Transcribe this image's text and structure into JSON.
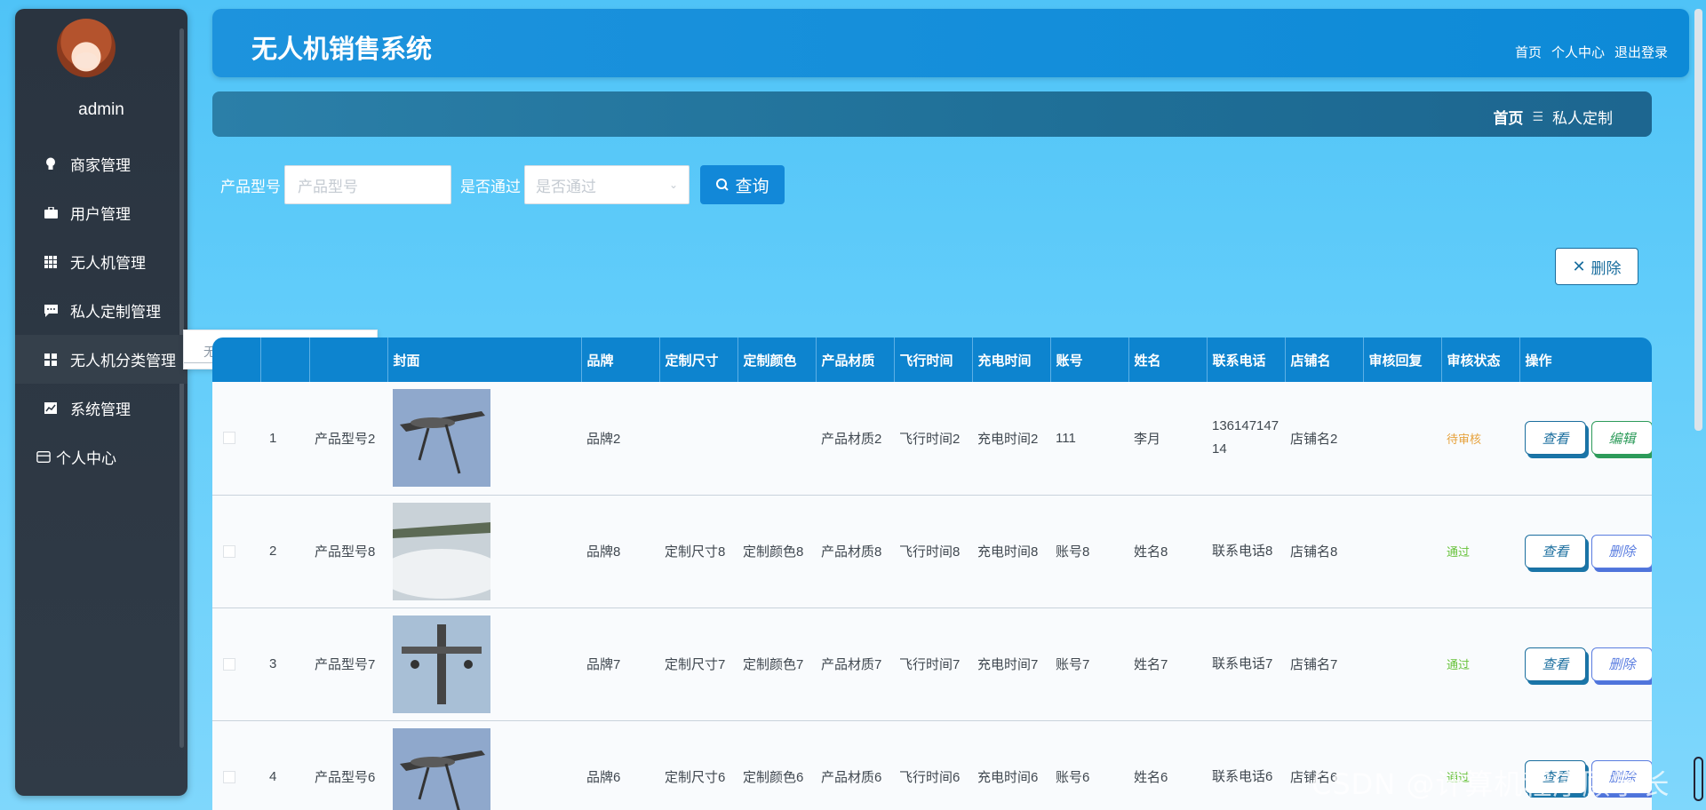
{
  "user": {
    "name": "admin"
  },
  "sidebar": {
    "items": [
      {
        "label": "商家管理",
        "icon": "lightbulb-icon"
      },
      {
        "label": "用户管理",
        "icon": "briefcase-icon"
      },
      {
        "label": "无人机管理",
        "icon": "grid-icon"
      },
      {
        "label": "私人定制管理",
        "icon": "chat-icon"
      },
      {
        "label": "无人机分类管理",
        "icon": "apps-icon"
      },
      {
        "label": "系统管理",
        "icon": "chart-icon"
      },
      {
        "label": "个人中心",
        "icon": "card-icon"
      }
    ],
    "submenu": {
      "label": "无人机分类"
    }
  },
  "header": {
    "title": "无人机销售系统",
    "links": [
      "首页",
      "个人中心",
      "退出登录"
    ]
  },
  "breadcrumb": {
    "home": "首页",
    "current": "私人定制"
  },
  "search": {
    "model_label": "产品型号",
    "model_placeholder": "产品型号",
    "pass_label": "是否通过",
    "pass_placeholder": "是否通过",
    "query_label": "查询"
  },
  "delete_label": "删除",
  "table": {
    "headers": [
      "",
      "",
      "",
      "封面",
      "品牌",
      "定制尺寸",
      "定制颜色",
      "产品材质",
      "飞行时间",
      "充电时间",
      "账号",
      "姓名",
      "联系电话",
      "店铺名",
      "审核回复",
      "审核状态",
      "操作"
    ],
    "rows": [
      {
        "index": "1",
        "model": "产品型号2",
        "brand": "品牌2",
        "size": "",
        "color": "",
        "material": "产品材质2",
        "flight": "飞行时间2",
        "charge": "充电时间2",
        "account": "111",
        "name": "李月",
        "phone": "13614714714",
        "shop": "店铺名2",
        "reply": "",
        "status": "待审核",
        "status_type": "pending",
        "op1": "查看",
        "op2": "编辑",
        "op2_type": "edit"
      },
      {
        "index": "2",
        "model": "产品型号8",
        "brand": "品牌8",
        "size": "定制尺寸8",
        "color": "定制颜色8",
        "material": "产品材质8",
        "flight": "飞行时间8",
        "charge": "充电时间8",
        "account": "账号8",
        "name": "姓名8",
        "phone": "联系电话8",
        "shop": "店铺名8",
        "reply": "",
        "status": "通过",
        "status_type": "pass",
        "op1": "查看",
        "op2": "删除",
        "op2_type": "del"
      },
      {
        "index": "3",
        "model": "产品型号7",
        "brand": "品牌7",
        "size": "定制尺寸7",
        "color": "定制颜色7",
        "material": "产品材质7",
        "flight": "飞行时间7",
        "charge": "充电时间7",
        "account": "账号7",
        "name": "姓名7",
        "phone": "联系电话7",
        "shop": "店铺名7",
        "reply": "",
        "status": "通过",
        "status_type": "pass",
        "op1": "查看",
        "op2": "删除",
        "op2_type": "del"
      },
      {
        "index": "4",
        "model": "产品型号6",
        "brand": "品牌6",
        "size": "定制尺寸6",
        "color": "定制颜色6",
        "material": "产品材质6",
        "flight": "飞行时间6",
        "charge": "充电时间6",
        "account": "账号6",
        "name": "姓名6",
        "phone": "联系电话6",
        "shop": "店铺名6",
        "reply": "",
        "status": "通过",
        "status_type": "pass",
        "op1": "查看",
        "op2": "删除",
        "op2_type": "del"
      }
    ]
  },
  "watermark": "CSDN @计算机程序顾学长",
  "colors": {
    "accent": "#1288d8",
    "sidebar_bg": "#2a3440",
    "pending": "#e6a23c",
    "pass": "#67c23a"
  }
}
